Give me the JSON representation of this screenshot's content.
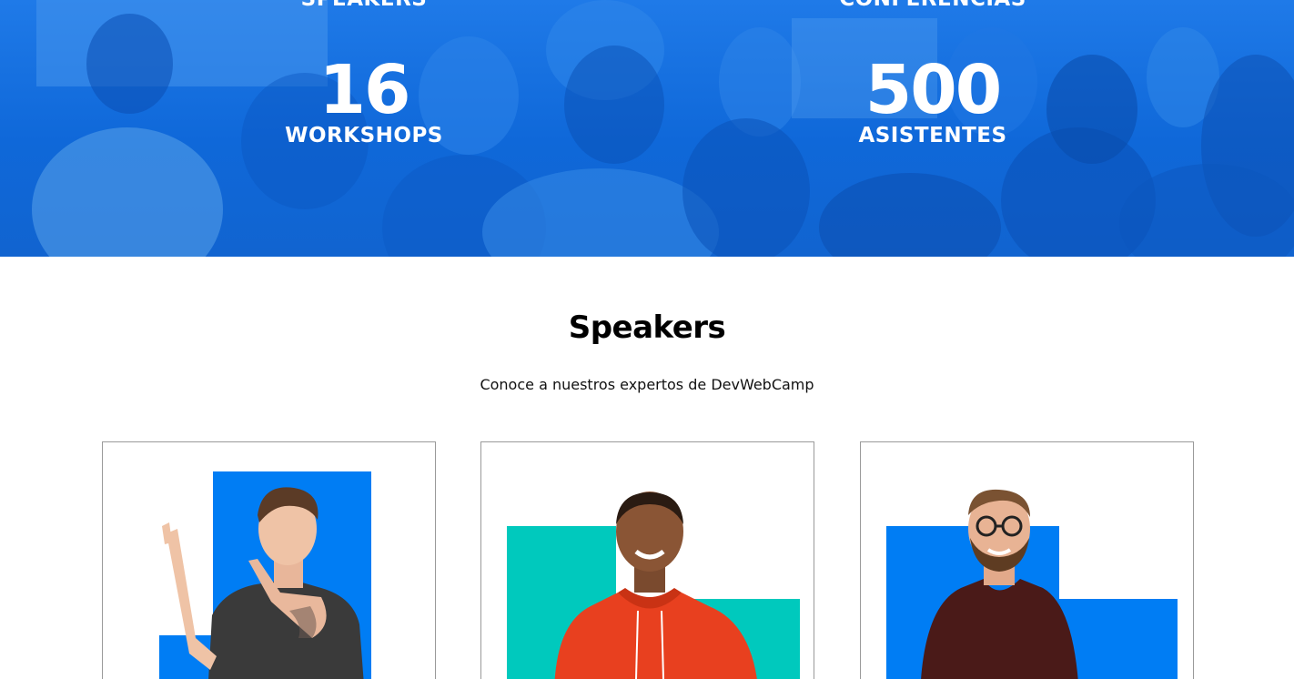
{
  "stats": {
    "top_left_label": "SPEAKERS",
    "top_right_label": "CONFERENCIAS",
    "items": [
      {
        "number": "16",
        "label": "WORKSHOPS"
      },
      {
        "number": "500",
        "label": "ASISTENTES"
      }
    ]
  },
  "speakers": {
    "title": "Speakers",
    "subtitle": "Conoce a nuestros expertos de DevWebCamp"
  },
  "colors": {
    "brand_blue": "#007df4",
    "teal": "#00c9bd",
    "banner_blue": "#1f7ae8"
  }
}
